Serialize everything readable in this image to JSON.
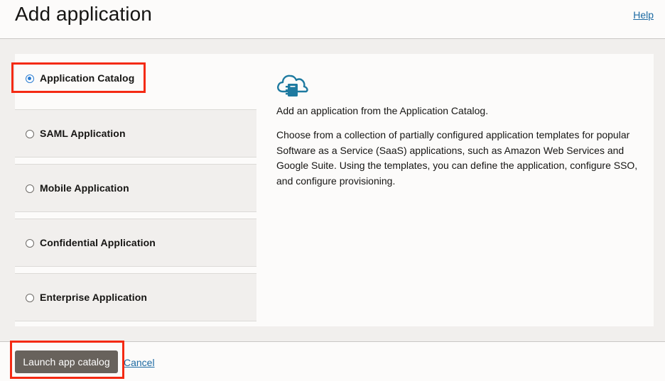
{
  "header": {
    "title": "Add application",
    "help_label": "Help"
  },
  "options": [
    {
      "label": "Application Catalog",
      "selected": true
    },
    {
      "label": "SAML Application",
      "selected": false
    },
    {
      "label": "Mobile Application",
      "selected": false
    },
    {
      "label": "Confidential Application",
      "selected": false
    },
    {
      "label": "Enterprise Application",
      "selected": false
    }
  ],
  "description": {
    "icon": "cloud-catalog-icon",
    "summary": "Add an application from the Application Catalog.",
    "detail": "Choose from a collection of partially configured application templates for popular Software as a Service (SaaS) applications, such as Amazon Web Services and Google Suite. Using the templates, you can define the application, configure SSO, and configure provisioning."
  },
  "footer": {
    "launch_label": "Launch app catalog",
    "cancel_label": "Cancel"
  },
  "colors": {
    "accent": "#2a7cd1",
    "highlight": "#f42a13",
    "button": "#68625c",
    "link": "#1c6aa3",
    "icon": "#1e7aa0"
  }
}
